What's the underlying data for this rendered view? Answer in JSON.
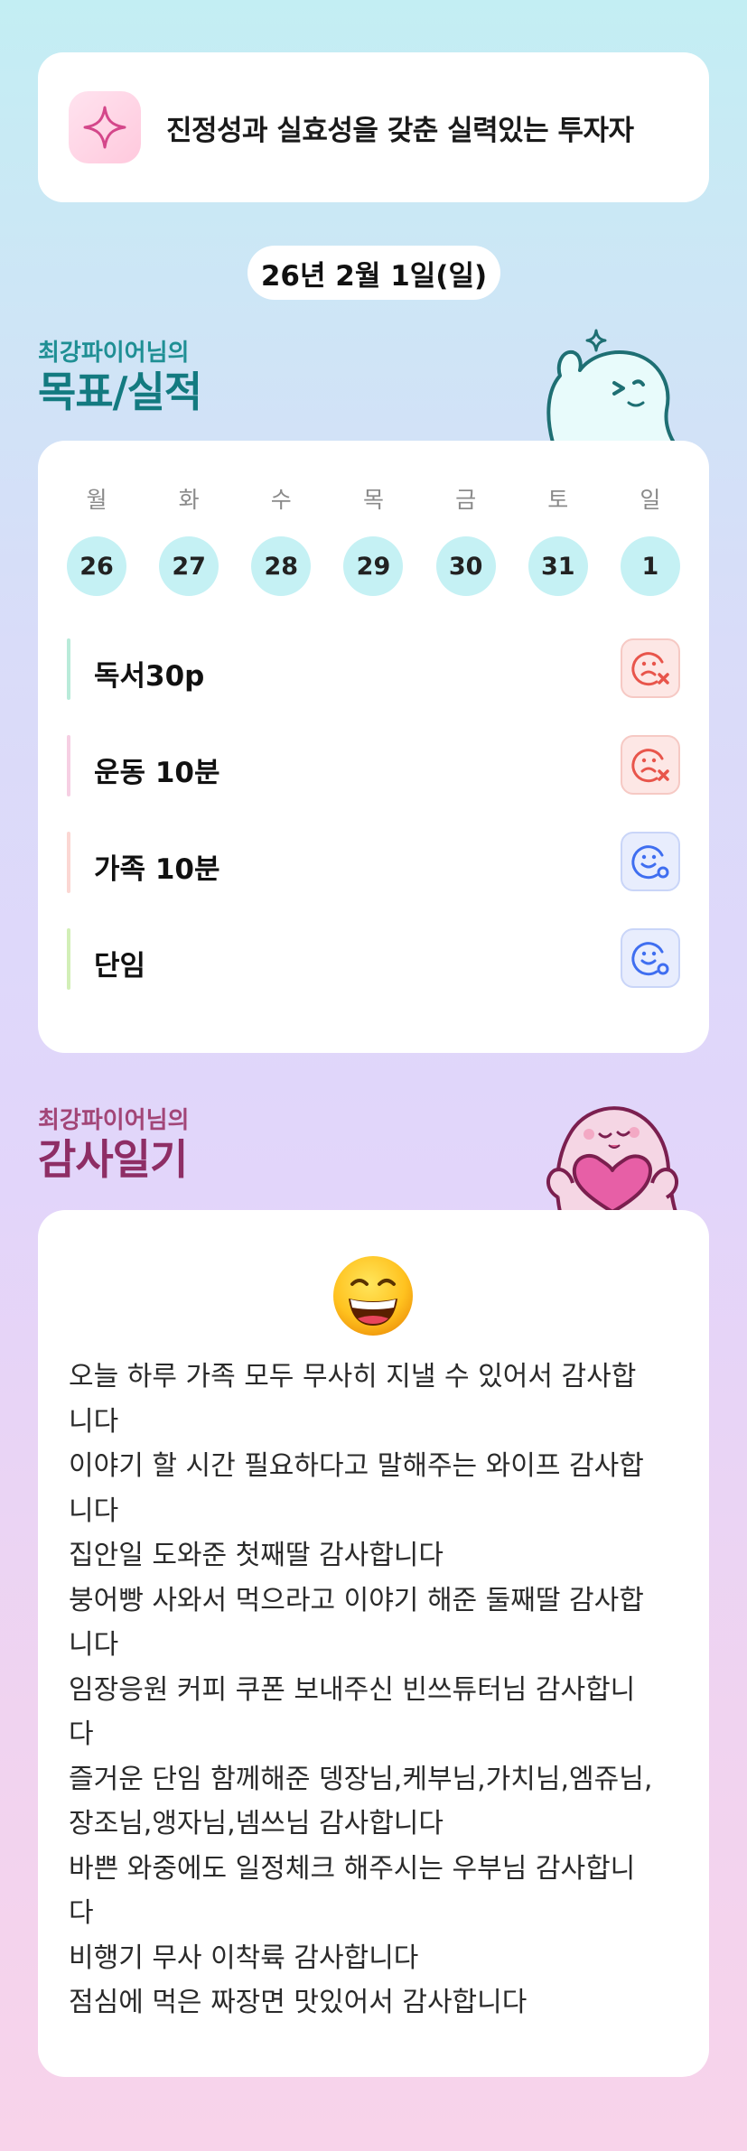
{
  "motto": {
    "icon": "sparkle-icon",
    "text": "진정성과 실효성을 갖춘 실력있는 투자자"
  },
  "date": "26년 2월 1일(일)",
  "goals_section": {
    "subtitle": "최강파이어님의",
    "title": "목표/실적"
  },
  "week": {
    "weekdays": [
      "월",
      "화",
      "수",
      "목",
      "금",
      "토",
      "일"
    ],
    "dates": [
      "26",
      "27",
      "28",
      "29",
      "30",
      "31",
      "1"
    ]
  },
  "goals": [
    {
      "label": "독서30p",
      "status": "fail",
      "bar_color": "#b9ebd9"
    },
    {
      "label": "운동 10분",
      "status": "fail",
      "bar_color": "#f6cfe3"
    },
    {
      "label": "가족 10분",
      "status": "done",
      "bar_color": "#fbd7d3"
    },
    {
      "label": "단임",
      "status": "done",
      "bar_color": "#d2efb7"
    }
  ],
  "diary_section": {
    "subtitle": "최강파이어님의",
    "title": "감사일기"
  },
  "diary": {
    "emoji": "grinning-face-icon",
    "lines": [
      "오늘 하루 가족 모두 무사히 지낼 수 있어서 감사합",
      "니다",
      "이야기 할 시간 필요하다고 말해주는 와이프 감사합",
      "니다",
      "집안일 도와준 첫째딸 감사합니다",
      "붕어빵 사와서 먹으라고 이야기 해준 둘째딸 감사합",
      "니다",
      "임장응원 커피 쿠폰 보내주신 빈쓰튜터님 감사합니",
      "다",
      "즐거운 단임 함께해준 뎅장님,케부님,가치님,엠쥬님,",
      "장조님,앵자님,넴쓰님 감사합니다",
      "바쁜 와중에도 일정체크 해주시는 우부님 감사합니",
      "다",
      "비행기 무사 이착륙 감사합니다",
      "점심에 먹은 짜장면 맛있어서 감사합니다"
    ]
  },
  "colors": {
    "teal": "#1f8f94",
    "plum": "#8e2e65",
    "date_circle": "#c5f1f4",
    "fail": "#e8554b",
    "done": "#3f6ef0"
  }
}
